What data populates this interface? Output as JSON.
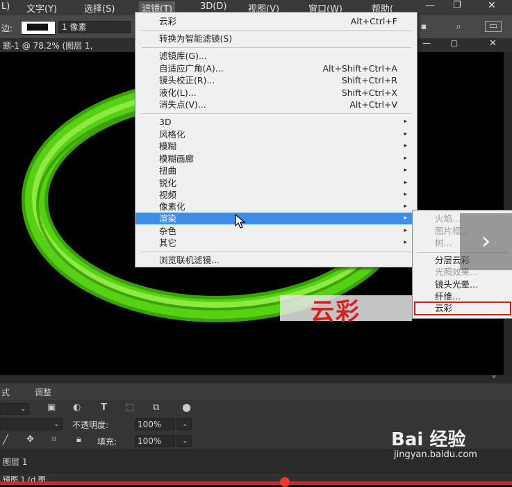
{
  "menubar": {
    "items": [
      "L)",
      "文字(Y)",
      "选择(S)",
      "滤镜(T)",
      "3D(D)",
      "视图(V)",
      "窗口(W)",
      "帮助("
    ]
  },
  "optionsbar": {
    "label_left": "边:",
    "stroke_width": "1 像素"
  },
  "document": {
    "tab_label": "题-1 @ 78.2% (图层 1,"
  },
  "filter_menu": {
    "items": [
      {
        "label": "云彩",
        "shortcut": "Alt+Ctrl+F"
      },
      {
        "label": "转换为智能滤镜(S)",
        "shortcut": ""
      },
      {
        "label": "滤镜库(G)...",
        "shortcut": ""
      },
      {
        "label": "自适应广角(A)...",
        "shortcut": "Alt+Shift+Ctrl+A"
      },
      {
        "label": "镜头校正(R)...",
        "shortcut": "Shift+Ctrl+R"
      },
      {
        "label": "液化(L)...",
        "shortcut": "Shift+Ctrl+X"
      },
      {
        "label": "消失点(V)...",
        "shortcut": "Alt+Ctrl+V"
      },
      {
        "label": "3D",
        "shortcut": ""
      },
      {
        "label": "风格化",
        "shortcut": ""
      },
      {
        "label": "模糊",
        "shortcut": ""
      },
      {
        "label": "模糊画廊",
        "shortcut": ""
      },
      {
        "label": "扭曲",
        "shortcut": ""
      },
      {
        "label": "锐化",
        "shortcut": ""
      },
      {
        "label": "视频",
        "shortcut": ""
      },
      {
        "label": "像素化",
        "shortcut": ""
      },
      {
        "label": "渲染",
        "shortcut": ""
      },
      {
        "label": "杂色",
        "shortcut": ""
      },
      {
        "label": "其它",
        "shortcut": ""
      },
      {
        "label": "浏览联机滤镜...",
        "shortcut": ""
      }
    ],
    "submenu_arrow": "▸"
  },
  "render_submenu": {
    "items": [
      {
        "label": "火焰...",
        "disabled": true
      },
      {
        "label": "图片框...",
        "disabled": true
      },
      {
        "label": "树...",
        "disabled": true
      },
      {
        "label": "分层云彩",
        "disabled": false
      },
      {
        "label": "光照效果...",
        "disabled": true
      },
      {
        "label": "镜头光晕...",
        "disabled": false
      },
      {
        "label": "纤维...",
        "disabled": false
      },
      {
        "label": "云彩",
        "disabled": false
      }
    ]
  },
  "annotation": {
    "text": "云彩"
  },
  "next_button": {
    "icon": "chevron-right-icon",
    "glyph": "›"
  },
  "panels": {
    "tab_left": "式",
    "tab_adjust": "调整",
    "opacity_label": "不透明度:",
    "opacity_value": "100%",
    "fill_label": "填充:",
    "fill_value": "100%",
    "layer_name": "图层 1",
    "bottom_text": "镜图 1 (d 图"
  },
  "watermark": {
    "brand": "Bai 经验",
    "url": "jingyan.baidu.com"
  },
  "colors": {
    "menu_highlight": "#3f8ee5",
    "annotation_red": "#d81e1e",
    "ring_green": "#4fdc12"
  }
}
